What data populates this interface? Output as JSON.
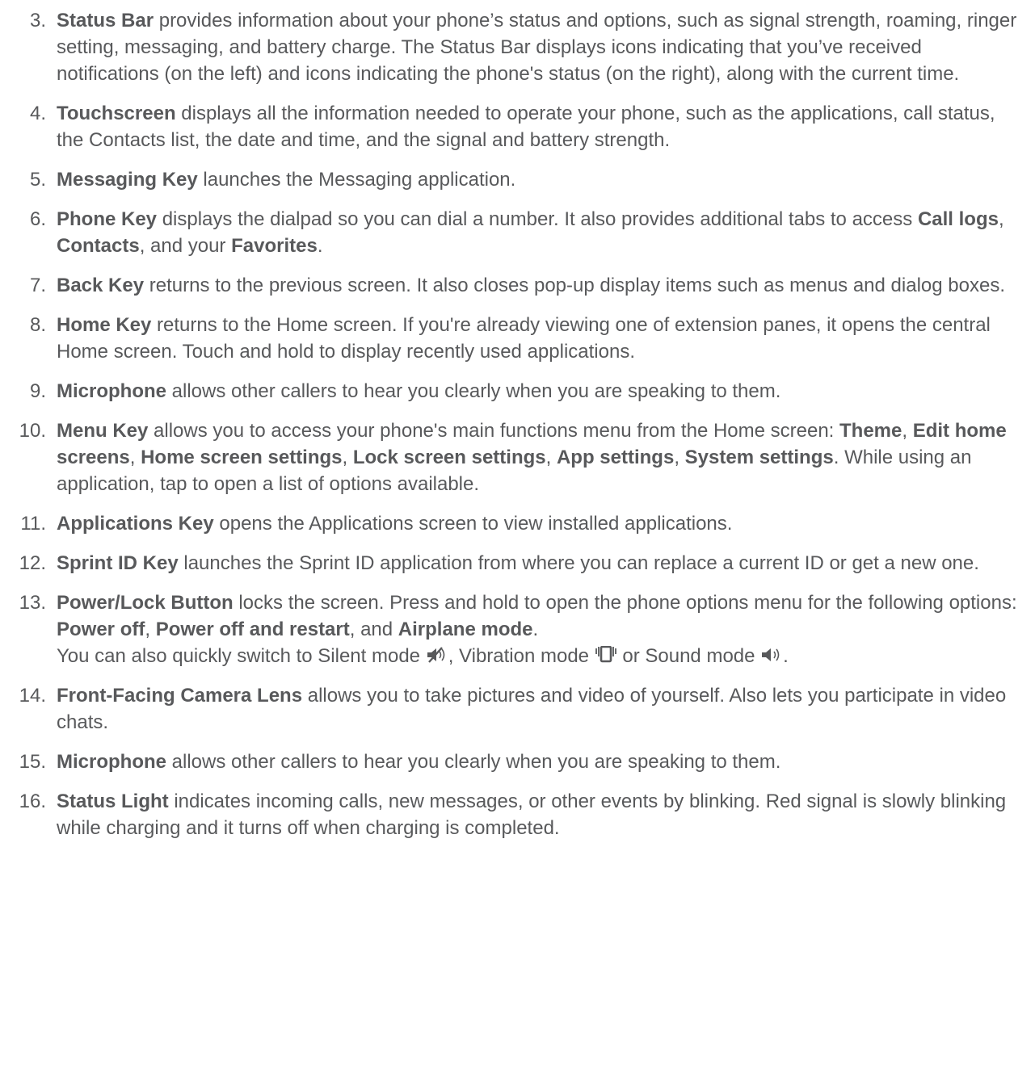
{
  "items": [
    {
      "num": "3.",
      "parts": [
        {
          "b": "Status Bar"
        },
        {
          "t": " provides information about your phone’s status and options, such as signal strength, roaming, ringer setting, messaging, and battery charge. The Status Bar displays icons indicating that you’ve received notifications (on the left) and icons indicating the phone's status (on the right), along with the current time."
        }
      ]
    },
    {
      "num": "4.",
      "parts": [
        {
          "b": "Touchscreen"
        },
        {
          "t": " displays all the information needed to operate your phone, such as the applications, call status, the Contacts list, the date and time, and the signal and battery strength."
        }
      ]
    },
    {
      "num": "5.",
      "parts": [
        {
          "b": "Messaging Key"
        },
        {
          "t": " launches the Messaging application."
        }
      ]
    },
    {
      "num": "6.",
      "parts": [
        {
          "b": "Phone Key"
        },
        {
          "t": " displays the dialpad so you can dial a number. It also provides additional tabs to access "
        },
        {
          "b": "Call logs"
        },
        {
          "t": ", "
        },
        {
          "b": "Contacts"
        },
        {
          "t": ", and your "
        },
        {
          "b": "Favorites"
        },
        {
          "t": "."
        }
      ]
    },
    {
      "num": "7.",
      "parts": [
        {
          "b": "Back Key"
        },
        {
          "t": " returns to the previous screen. It also closes pop-up display items such as menus and dialog boxes."
        }
      ]
    },
    {
      "num": "8.",
      "parts": [
        {
          "b": "Home Key"
        },
        {
          "t": " returns to the Home screen. If you're already viewing one of extension panes, it opens the central Home screen. Touch and hold to display recently used applications."
        }
      ]
    },
    {
      "num": "9.",
      "parts": [
        {
          "b": "Microphone"
        },
        {
          "t": " allows other callers to hear you clearly when you are speaking to them."
        }
      ]
    },
    {
      "num": "10.",
      "parts": [
        {
          "b": "Menu Key"
        },
        {
          "t": " allows you to access your phone's main functions menu from the Home screen: "
        },
        {
          "b": "Theme"
        },
        {
          "t": ", "
        },
        {
          "b": "Edit home screens"
        },
        {
          "t": ", "
        },
        {
          "b": "Home screen settings"
        },
        {
          "t": ", "
        },
        {
          "b": "Lock screen settings"
        },
        {
          "t": ", "
        },
        {
          "b": "App settings"
        },
        {
          "t": ", "
        },
        {
          "b": "System settings"
        },
        {
          "t": ". While using an application, tap to open a list of options available."
        }
      ]
    },
    {
      "num": "11.",
      "parts": [
        {
          "b": "Applications Key"
        },
        {
          "t": " opens the Applications screen to view installed applications."
        }
      ]
    },
    {
      "num": "12.",
      "parts": [
        {
          "b": "Sprint ID Key"
        },
        {
          "t": " launches the Sprint ID application from where you can replace a current ID or get a new one."
        }
      ]
    },
    {
      "num": "13.",
      "parts": [
        {
          "b": "Power/Lock Button"
        },
        {
          "t": " locks the screen. Press and hold to open the phone options menu for the following options: "
        },
        {
          "b": "Power off"
        },
        {
          "t": ", "
        },
        {
          "b": "Power off and restart"
        },
        {
          "t": ", and "
        },
        {
          "b": "Airplane mode"
        },
        {
          "t": "."
        }
      ],
      "line2": [
        {
          "t": "You can also quickly switch to Silent mode "
        },
        {
          "icon": "silent-mode-icon"
        },
        {
          "t": ", Vibration mode "
        },
        {
          "icon": "vibration-mode-icon"
        },
        {
          "t": " or Sound mode "
        },
        {
          "icon": "sound-mode-icon"
        },
        {
          "t": "."
        }
      ]
    },
    {
      "num": "14.",
      "parts": [
        {
          "b": "Front-Facing Camera Lens"
        },
        {
          "t": " allows you to take pictures and video of yourself. Also lets you participate in video chats."
        }
      ]
    },
    {
      "num": "15.",
      "parts": [
        {
          "b": "Microphone"
        },
        {
          "t": " allows other callers to hear you clearly when you are speaking to them."
        }
      ]
    },
    {
      "num": "16.",
      "parts": [
        {
          "b": "Status Light"
        },
        {
          "t": " indicates incoming calls, new messages, or other events by blinking. Red signal is slowly blinking while charging and it turns off when charging is completed."
        }
      ]
    }
  ],
  "colors": {
    "text": "#58595b"
  }
}
